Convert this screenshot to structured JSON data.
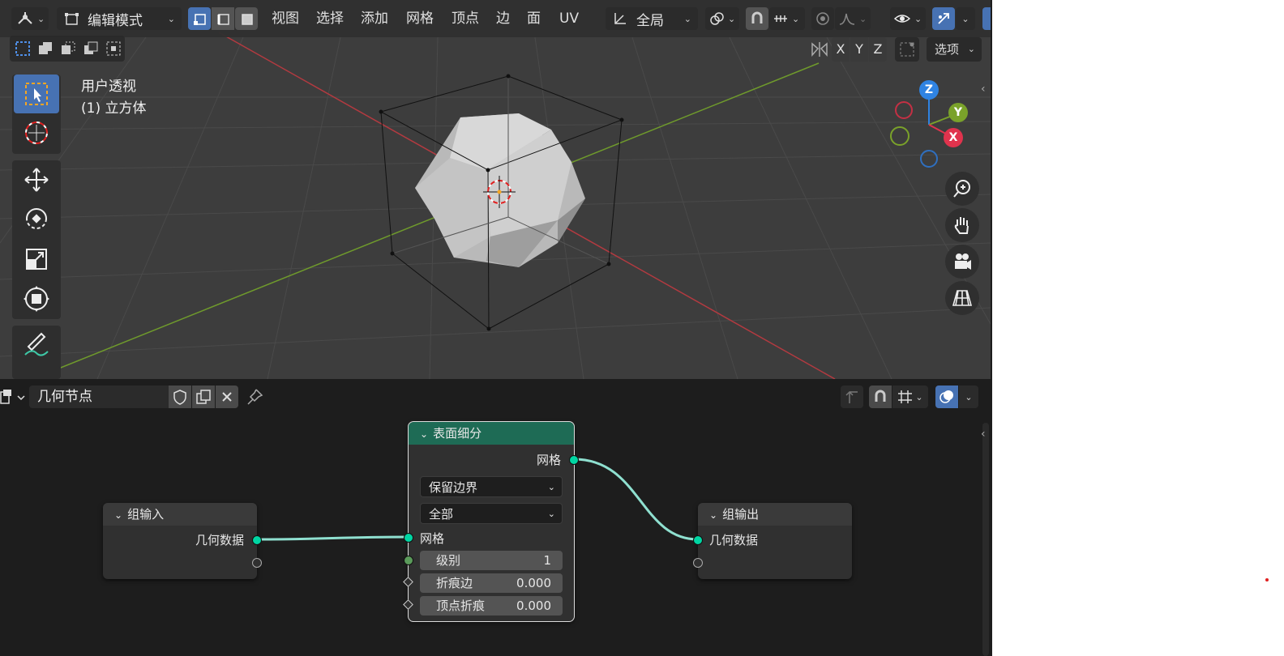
{
  "header": {
    "mode_label": "编辑模式",
    "menus": [
      "视图",
      "选择",
      "添加",
      "网格",
      "顶点",
      "边",
      "面",
      "UV"
    ],
    "transform_orientation": "全局",
    "options_label": "选项",
    "axes": [
      "X",
      "Y",
      "Z"
    ]
  },
  "viewport": {
    "view_name": "用户透视",
    "object_name": "(1) 立方体",
    "gizmo_axes": {
      "x": "X",
      "y": "Y",
      "z": "Z"
    }
  },
  "node_editor": {
    "tree_name": "几何节点",
    "nodes": {
      "group_input": {
        "title": "组输入",
        "output": "几何数据"
      },
      "subdivide": {
        "title": "表面细分",
        "output": "网格",
        "uv_smooth": "保留边界",
        "boundary": "全部",
        "input_mesh": "网格",
        "level_label": "级别",
        "level_value": "1",
        "edge_crease_label": "折痕边",
        "edge_crease_value": "0.000",
        "vertex_crease_label": "顶点折痕",
        "vertex_crease_value": "0.000"
      },
      "group_output": {
        "title": "组输出",
        "input": "几何数据"
      }
    }
  },
  "colors": {
    "accent_blue": "#4772b3",
    "geometry_socket": "#00d6a3",
    "node_header_green": "#1e6b55",
    "axis_x": "#e0334d",
    "axis_y": "#7aa22a",
    "axis_z": "#2f83e2"
  }
}
